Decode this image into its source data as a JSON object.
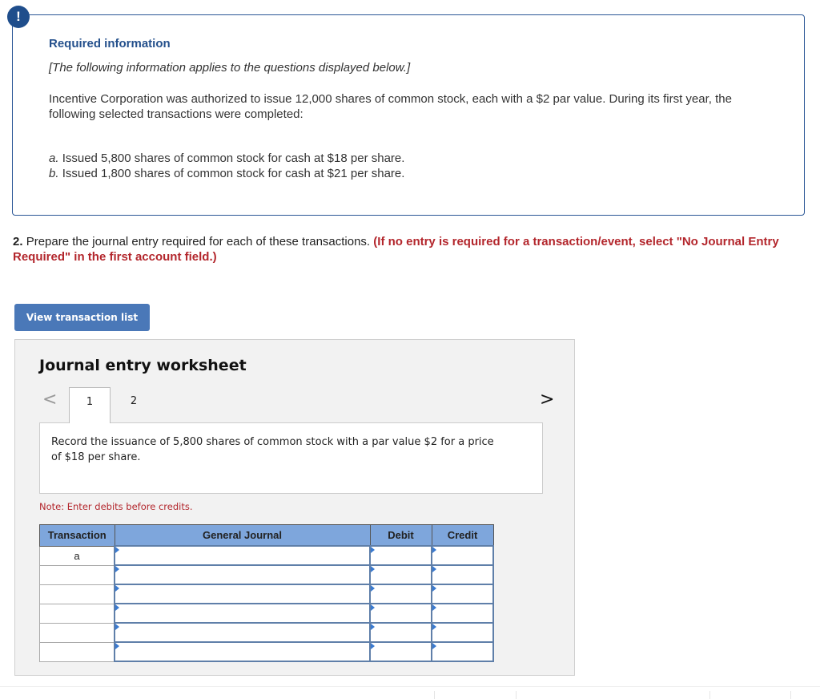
{
  "info": {
    "icon": "exclamation-icon",
    "icon_glyph": "!",
    "title": "Required information",
    "italic_note": "[The following information applies to the questions displayed below.]",
    "body": "Incentive Corporation was authorized to issue 12,000 shares of common stock, each with a $2 par value. During its first year, the following selected transactions were completed:",
    "transactions": [
      {
        "letter": "a.",
        "text": "Issued 5,800 shares of common stock for cash at $18 per share."
      },
      {
        "letter": "b.",
        "text": "Issued 1,800 shares of common stock for cash at $21 per share."
      }
    ]
  },
  "question": {
    "number": "2.",
    "text": "Prepare the journal entry required for each of these transactions.",
    "instruction": "(If no entry is required for a transaction/event, select \"No Journal Entry Required\" in the first account field.)"
  },
  "view_button": {
    "label": "View transaction list"
  },
  "worksheet": {
    "title": "Journal entry worksheet",
    "prev_glyph": "<",
    "next_glyph": ">",
    "tabs": [
      {
        "label": "1",
        "active": true
      },
      {
        "label": "2",
        "active": false
      }
    ],
    "description": "Record the issuance of 5,800 shares of common stock with a par value $2 for a price of $18 per share.",
    "note": "Note: Enter debits before credits.",
    "table": {
      "headers": [
        "Transaction",
        "General Journal",
        "Debit",
        "Credit"
      ],
      "rows": [
        {
          "transaction": "a",
          "account": "",
          "debit": "",
          "credit": ""
        },
        {
          "transaction": "",
          "account": "",
          "debit": "",
          "credit": ""
        },
        {
          "transaction": "",
          "account": "",
          "debit": "",
          "credit": ""
        },
        {
          "transaction": "",
          "account": "",
          "debit": "",
          "credit": ""
        },
        {
          "transaction": "",
          "account": "",
          "debit": "",
          "credit": ""
        },
        {
          "transaction": "",
          "account": "",
          "debit": "",
          "credit": ""
        }
      ]
    }
  },
  "colors": {
    "accent_blue": "#1f4e8c",
    "button_blue": "#4a78b8",
    "header_blue": "#7ea6dc",
    "instruction_red": "#b3262c"
  }
}
